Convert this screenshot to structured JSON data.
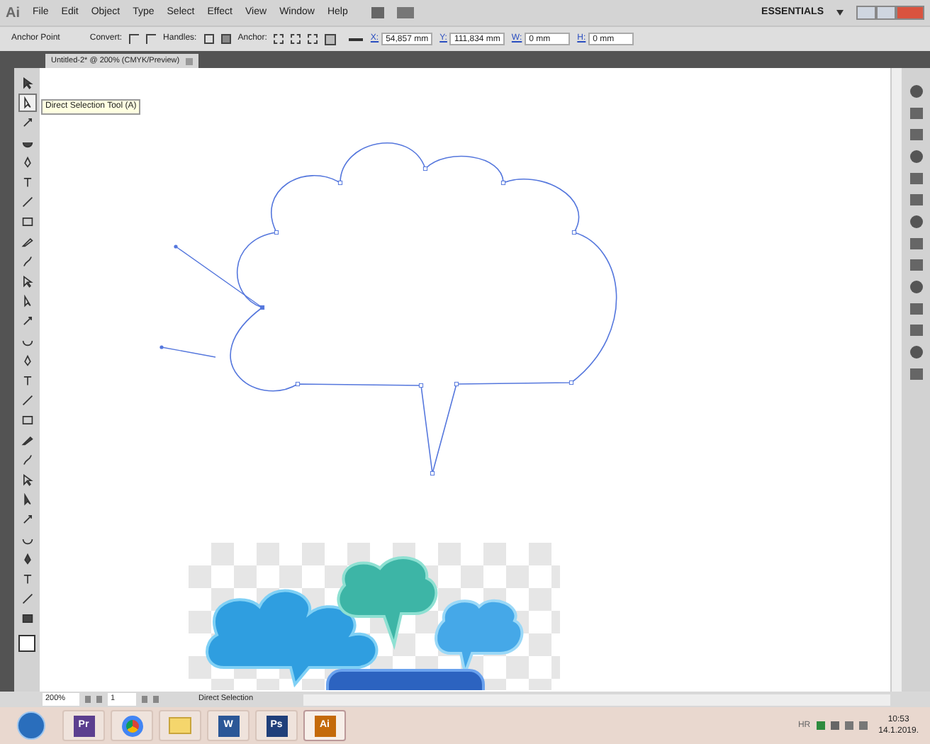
{
  "app": {
    "logo": "Ai",
    "menus": [
      "File",
      "Edit",
      "Object",
      "Type",
      "Select",
      "Effect",
      "View",
      "Window",
      "Help"
    ],
    "workspace": "ESSENTIALS"
  },
  "control_bar": {
    "label": "Anchor Point",
    "convert": "Convert:",
    "handles": "Handles:",
    "anchor": "Anchor:",
    "fields": [
      {
        "label": "X:",
        "value": "54,857 mm"
      },
      {
        "label": "Y:",
        "value": "111,834 mm"
      },
      {
        "label": "W:",
        "value": "0 mm"
      },
      {
        "label": "H:",
        "value": "0 mm"
      }
    ]
  },
  "document_tab": {
    "title": "Untitled-2* @ 200% (CMYK/Preview)"
  },
  "tools": [
    {
      "selected": false
    },
    {
      "selected": true
    },
    {
      "selected": false
    },
    {
      "selected": false
    },
    {
      "selected": false
    },
    {
      "selected": false
    },
    {
      "selected": false
    },
    {
      "selected": false
    },
    {
      "selected": false
    },
    {
      "selected": false
    },
    {
      "selected": false
    },
    {
      "selected": false
    },
    {
      "selected": false
    },
    {
      "selected": false
    },
    {
      "selected": false
    },
    {
      "selected": false
    },
    {
      "selected": false
    },
    {
      "selected": false
    },
    {
      "selected": false
    },
    {
      "selected": false
    },
    {
      "selected": false
    },
    {
      "selected": false
    },
    {
      "selected": false
    },
    {
      "selected": false
    },
    {
      "selected": false
    },
    {
      "selected": false
    },
    {
      "selected": false
    },
    {
      "selected": false
    }
  ],
  "tooltip": "Direct Selection Tool (A)",
  "status_bar": {
    "zoom": "200%",
    "page": "1",
    "status": "Direct Selection"
  },
  "taskbar": {
    "apps": [
      {
        "kind": "text",
        "label": "Pr",
        "color": "#5b3f8f",
        "selected": false
      },
      {
        "kind": "chrome",
        "selected": false
      },
      {
        "kind": "folder",
        "selected": false
      },
      {
        "kind": "text",
        "label": "W",
        "color": "#2b5797",
        "selected": false
      },
      {
        "kind": "text",
        "label": "Ps",
        "color": "#1f3f7a",
        "selected": false
      },
      {
        "kind": "text",
        "label": "Ai",
        "color": "#c46a0a",
        "selected": true
      }
    ],
    "language": "HR",
    "time": "10:53",
    "date": "14.1.2019."
  }
}
